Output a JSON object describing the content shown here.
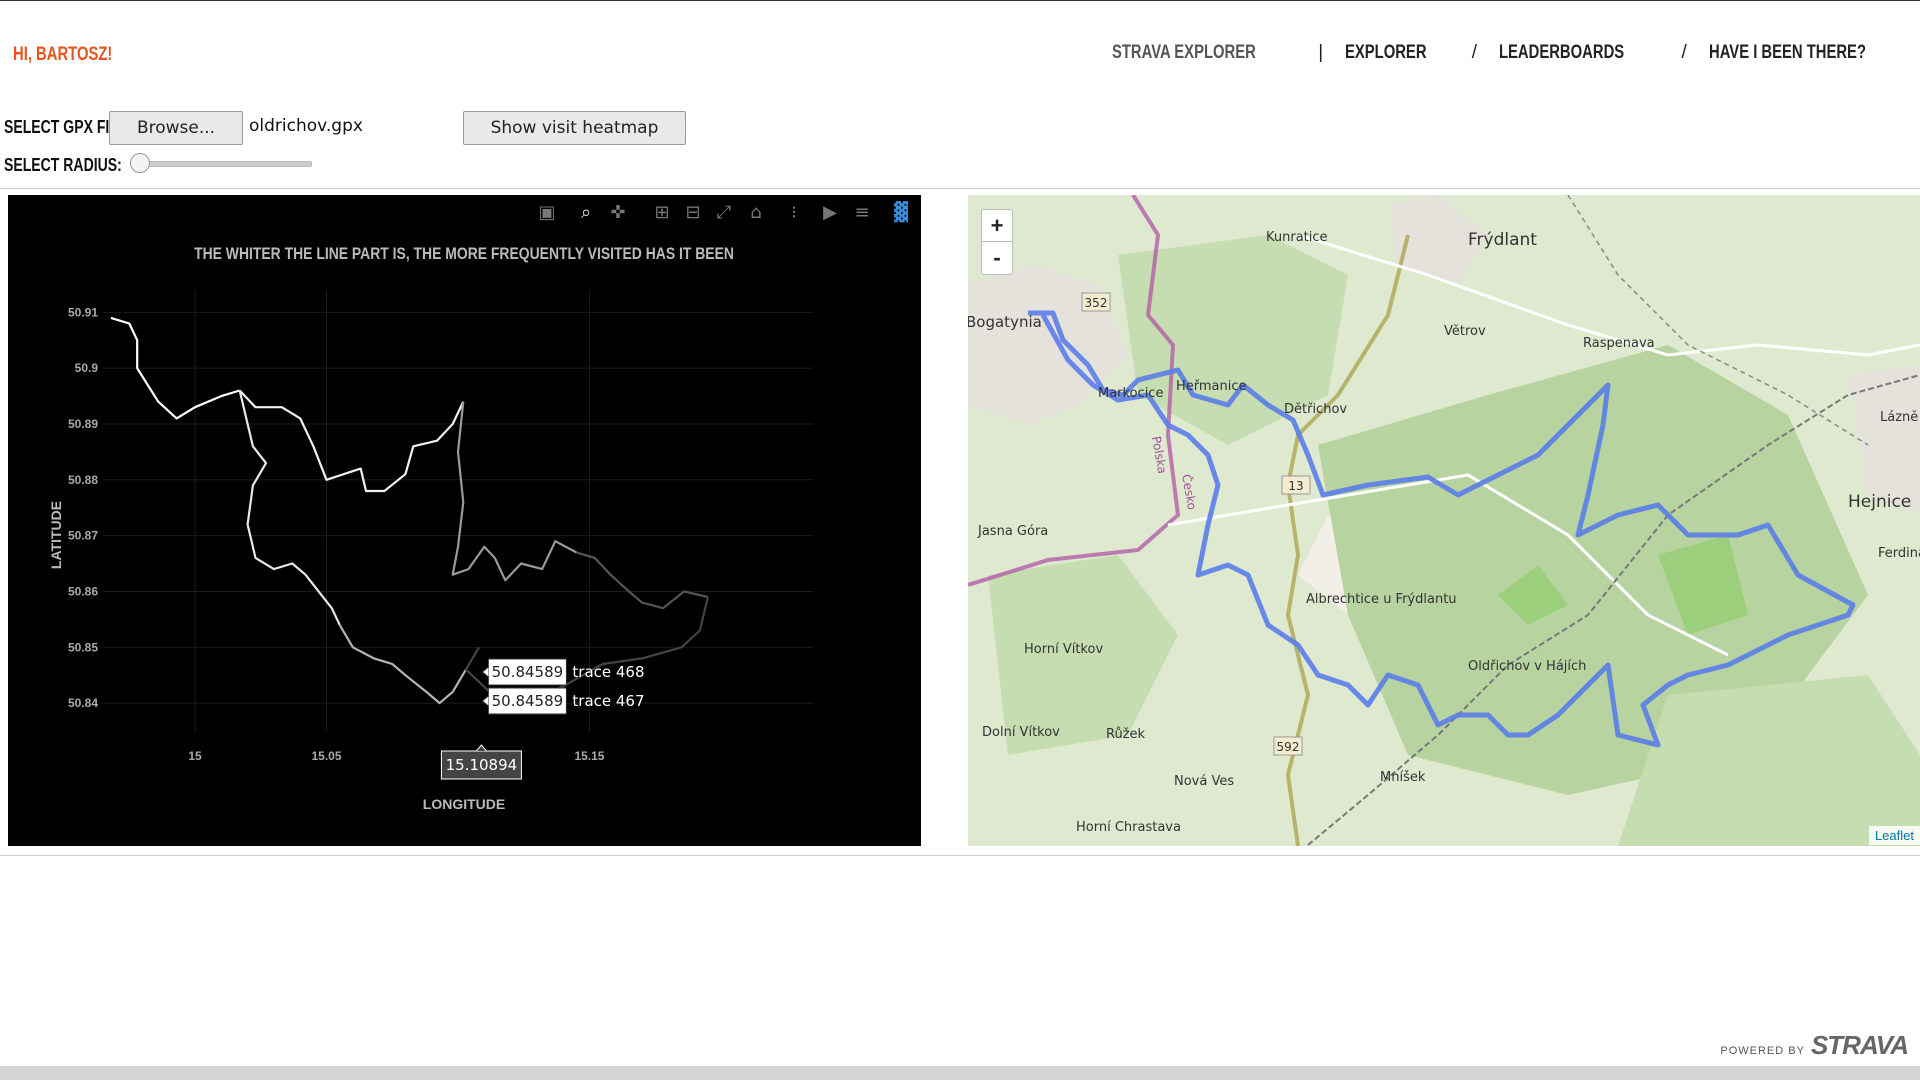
{
  "header": {
    "greeting": "HI, BARTOSZ!",
    "nav": [
      "STRAVA EXPLORER",
      "EXPLORER",
      "LEADERBOARDS",
      "HAVE I BEEN THERE?"
    ],
    "separators": [
      "|",
      "/",
      "/"
    ]
  },
  "controls": {
    "gpx_label": "SELECT GPX FILE:",
    "browse_label": "Browse...",
    "file_name": "oldrichov.gpx",
    "heatmap_button": "Show visit heatmap",
    "radius_label": "SELECT RADIUS:",
    "radius_value": 0.02
  },
  "chart_data": {
    "type": "line",
    "title": "THE WHITER THE LINE PART IS, THE MORE FREQUENTLY VISITED HAS IT BEEN",
    "xlabel": "LONGITUDE",
    "ylabel": "LATITUDE",
    "xlim": [
      14.965,
      15.235
    ],
    "ylim": [
      50.835,
      50.914
    ],
    "xticks": [
      15,
      15.05,
      15.15
    ],
    "yticks": [
      50.84,
      50.85,
      50.86,
      50.87,
      50.88,
      50.89,
      50.9,
      50.91
    ],
    "background": "#000000",
    "segments": [
      {
        "shade": "#ffffff",
        "points": [
          [
            14.968,
            50.909
          ],
          [
            14.975,
            50.908
          ],
          [
            14.978,
            50.905
          ],
          [
            14.978,
            50.9
          ],
          [
            14.982,
            50.897
          ],
          [
            14.986,
            50.894
          ],
          [
            14.993,
            50.891
          ],
          [
            15.0,
            50.893
          ],
          [
            15.01,
            50.895
          ],
          [
            15.017,
            50.896
          ]
        ]
      },
      {
        "shade": "#f0f0f0",
        "points": [
          [
            15.017,
            50.896
          ],
          [
            15.023,
            50.893
          ],
          [
            15.033,
            50.893
          ],
          [
            15.04,
            50.891
          ],
          [
            15.045,
            50.886
          ],
          [
            15.05,
            50.88
          ],
          [
            15.063,
            50.882
          ],
          [
            15.065,
            50.878
          ],
          [
            15.072,
            50.878
          ],
          [
            15.08,
            50.881
          ],
          [
            15.083,
            50.886
          ],
          [
            15.092,
            50.887
          ],
          [
            15.098,
            50.89
          ],
          [
            15.102,
            50.894
          ]
        ]
      },
      {
        "shade": "#e8e8e8",
        "points": [
          [
            15.017,
            50.896
          ],
          [
            15.02,
            50.89
          ],
          [
            15.022,
            50.886
          ],
          [
            15.027,
            50.883
          ],
          [
            15.022,
            50.879
          ],
          [
            15.02,
            50.872
          ],
          [
            15.023,
            50.866
          ],
          [
            15.03,
            50.864
          ],
          [
            15.037,
            50.865
          ],
          [
            15.042,
            50.863
          ],
          [
            15.047,
            50.86
          ],
          [
            15.052,
            50.857
          ],
          [
            15.055,
            50.854
          ]
        ]
      },
      {
        "shade": "#b4b4b4",
        "points": [
          [
            15.055,
            50.854
          ],
          [
            15.06,
            50.85
          ],
          [
            15.068,
            50.848
          ],
          [
            15.075,
            50.847
          ],
          [
            15.08,
            50.845
          ],
          [
            15.088,
            50.842
          ],
          [
            15.093,
            50.84
          ],
          [
            15.098,
            50.842
          ],
          [
            15.103,
            50.846
          ]
        ]
      },
      {
        "shade": "#9a9a9a",
        "points": [
          [
            15.102,
            50.894
          ],
          [
            15.1,
            50.885
          ],
          [
            15.102,
            50.876
          ],
          [
            15.1,
            50.868
          ],
          [
            15.098,
            50.863
          ],
          [
            15.104,
            50.864
          ],
          [
            15.11,
            50.868
          ],
          [
            15.114,
            50.866
          ],
          [
            15.118,
            50.862
          ],
          [
            15.124,
            50.865
          ],
          [
            15.132,
            50.864
          ],
          [
            15.137,
            50.869
          ],
          [
            15.145,
            50.867
          ]
        ]
      },
      {
        "shade": "#555555",
        "points": [
          [
            15.145,
            50.867
          ],
          [
            15.152,
            50.866
          ],
          [
            15.158,
            50.863
          ],
          [
            15.165,
            50.86
          ],
          [
            15.17,
            50.858
          ],
          [
            15.178,
            50.857
          ],
          [
            15.186,
            50.86
          ],
          [
            15.195,
            50.859
          ]
        ]
      },
      {
        "shade": "#444444",
        "points": [
          [
            15.195,
            50.859
          ],
          [
            15.192,
            50.853
          ],
          [
            15.185,
            50.85
          ],
          [
            15.17,
            50.848
          ],
          [
            15.155,
            50.847
          ],
          [
            15.14,
            50.843
          ],
          [
            15.125,
            50.84
          ],
          [
            15.112,
            50.842
          ],
          [
            15.103,
            50.846
          ],
          [
            15.108,
            50.85
          ]
        ]
      }
    ],
    "hover": {
      "x_label": "15.10894",
      "labels": [
        {
          "value": "50.84589",
          "trace": "trace 468"
        },
        {
          "value": "50.84589",
          "trace": "trace 467"
        }
      ]
    }
  },
  "toolbar": {
    "icons": [
      "camera-icon",
      "zoom-icon",
      "pan-icon",
      "zoom-in-icon",
      "zoom-out-icon",
      "autoscale-icon",
      "home-icon",
      "spike-lines-icon",
      "hover-closest-icon",
      "hover-compare-icon",
      "plotly-logo-icon"
    ]
  },
  "map": {
    "zoom_in": "+",
    "zoom_out": "-",
    "attribution": "Leaflet",
    "route_color": "#5a7de8",
    "places": [
      "Frýdlant",
      "Kunratice",
      "Bogatynia",
      "Markocice",
      "Heřmanice",
      "Dětřichov",
      "Větrov",
      "Raspenava",
      "Lázně Libverda",
      "Hejnice",
      "Ferdinandov",
      "Jasna Góra",
      "Albrechtice u Frýdlantu",
      "Horní Vítkov",
      "Oldřichov v Hájích",
      "Dolní Vítkov",
      "Růžek",
      "Nová Ves",
      "Mníšek",
      "Horní Chrastava",
      "Polska",
      "Česko"
    ],
    "road_numbers": [
      "352",
      "13",
      "592"
    ]
  },
  "footer": {
    "powered": "POWERED BY",
    "brand": "STRAVA"
  }
}
